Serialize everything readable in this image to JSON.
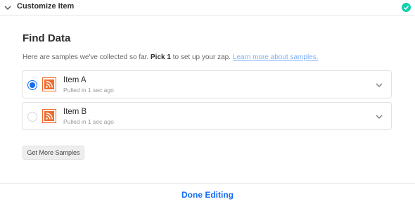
{
  "header": {
    "title": "Customize Item",
    "collapse_icon": "chevron-down-icon",
    "status_icon": "check-circle-icon",
    "status_color": "#13d0ab"
  },
  "main": {
    "title": "Find Data",
    "description": {
      "prefix": "Here are samples we've collected so far.",
      "pick": "Pick 1",
      "middle": "to set up your zap.",
      "link": "Learn more about samples."
    },
    "samples": [
      {
        "name": "Item A",
        "subtitle": "Pulled in 1 sec ago",
        "selected": true,
        "icon": "rss-icon"
      },
      {
        "name": "Item B",
        "subtitle": "Pulled in 1 sec ago",
        "selected": false,
        "icon": "rss-icon"
      }
    ],
    "more_button": "Get More Samples"
  },
  "footer": {
    "done_label": "Done Editing"
  },
  "colors": {
    "accent": "#136bf5",
    "rss": "#ee6b2f"
  }
}
